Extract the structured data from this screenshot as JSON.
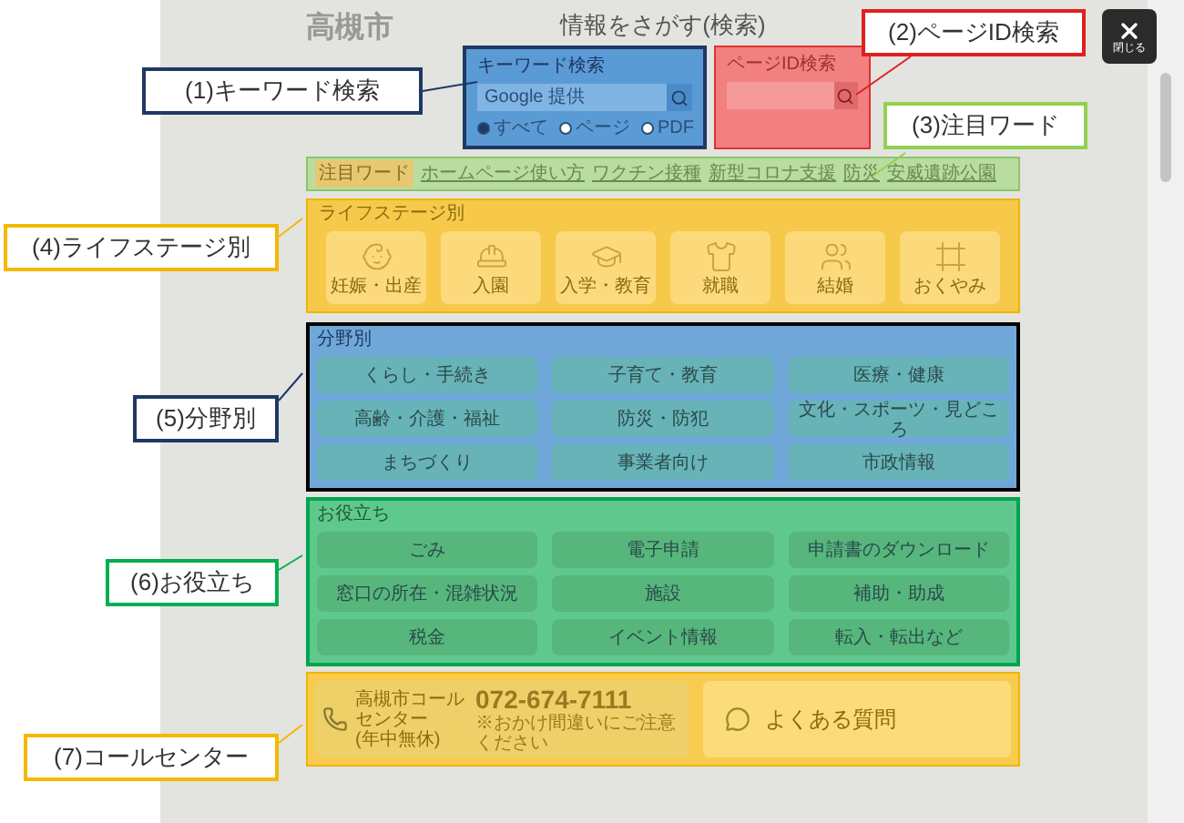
{
  "background_logo": "高槻市",
  "title": "情報をさがす(検索)",
  "close_button": {
    "label": "閉じる"
  },
  "keyword_search": {
    "label": "キーワード検索",
    "placeholder": "Google 提供",
    "options": [
      {
        "label": "すべて",
        "selected": true
      },
      {
        "label": "ページ",
        "selected": false
      },
      {
        "label": "PDF",
        "selected": false
      }
    ]
  },
  "page_id_search": {
    "label": "ページID検索"
  },
  "featured_words": {
    "badge": "注目ワード",
    "links": [
      "ホームページ使い方",
      "ワクチン接種",
      "新型コロナ支援",
      "防災",
      "安威遺跡公園"
    ]
  },
  "life_stage": {
    "heading": "ライフステージ別",
    "items": [
      "妊娠・出産",
      "入園",
      "入学・教育",
      "就職",
      "結婚",
      "おくやみ"
    ]
  },
  "by_field": {
    "heading": "分野別",
    "items": [
      "くらし・手続き",
      "子育て・教育",
      "医療・健康",
      "高齢・介護・福祉",
      "防災・防犯",
      "文化・スポーツ・見どころ",
      "まちづくり",
      "事業者向け",
      "市政情報"
    ]
  },
  "useful": {
    "heading": "お役立ち",
    "items": [
      "ごみ",
      "電子申請",
      "申請書のダウンロード",
      "窓口の所在・混雑状況",
      "施設",
      "補助・助成",
      "税金",
      "イベント情報",
      "転入・転出など"
    ]
  },
  "call_center": {
    "name": "高槻市コールセンター",
    "hours": "(年中無休)",
    "phone": "072-674-7111",
    "note": "※おかけ間違いにご注意ください",
    "faq": "よくある質問"
  },
  "callouts": [
    {
      "label": "(1)キーワード検索",
      "color": "#1f3864"
    },
    {
      "label": "(2)ページID検索",
      "color": "#e02020"
    },
    {
      "label": "(3)注目ワード",
      "color": "#92d050"
    },
    {
      "label": "(4)ライフステージ別",
      "color": "#f5b800"
    },
    {
      "label": "(5)分野別",
      "color": "#1f3864"
    },
    {
      "label": "(6)お役立ち",
      "color": "#00b050"
    },
    {
      "label": "(7)コールセンター",
      "color": "#f5b800"
    }
  ]
}
